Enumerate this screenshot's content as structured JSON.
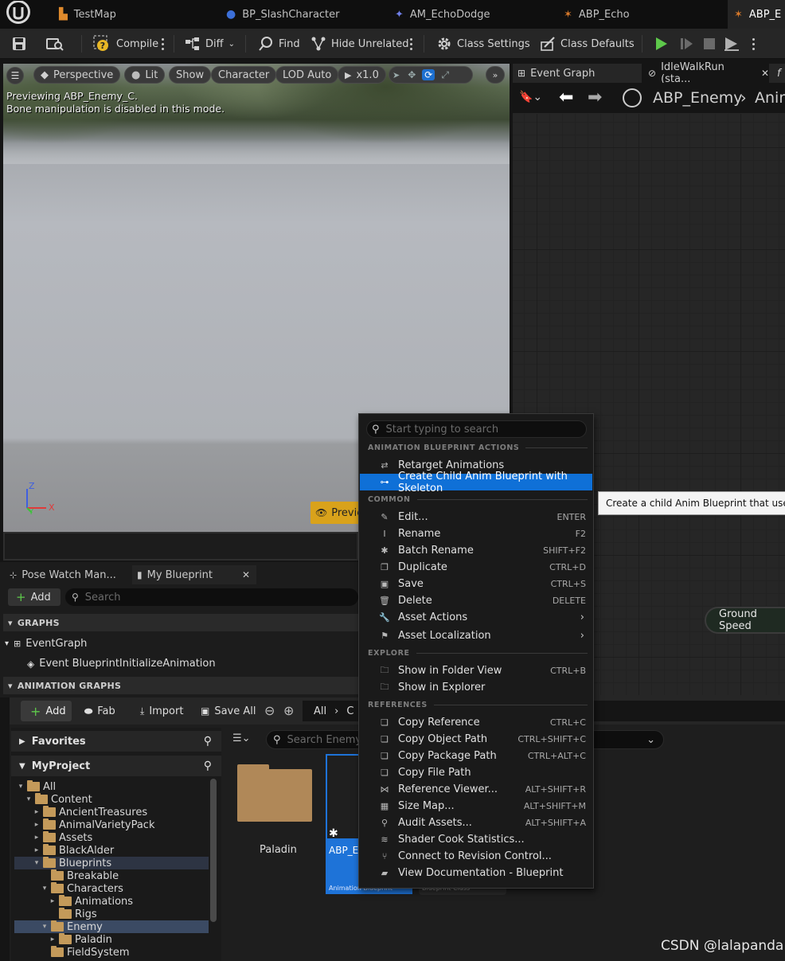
{
  "tabs": [
    "TestMap",
    "BP_SlashCharacter",
    "AM_EchoDodge",
    "ABP_Echo",
    "ABP_E"
  ],
  "toolbar": {
    "compile": "Compile",
    "diff": "Diff",
    "find": "Find",
    "hide_unrelated": "Hide Unrelated",
    "class_settings": "Class Settings",
    "class_defaults": "Class Defaults"
  },
  "viewport": {
    "perspective": "Perspective",
    "lit": "Lit",
    "show": "Show",
    "character": "Character",
    "lod": "LOD Auto",
    "speed": "x1.0",
    "preview_line1": "Previewing ABP_Enemy_C.",
    "preview_line2": "Bone manipulation is disabled in this mode.",
    "preview_button": "Previe",
    "axis_z": "Z",
    "axis_x": "X",
    "axis_y": "Y"
  },
  "graph": {
    "tab_event": "Event Graph",
    "tab_idle": "IdleWalkRun (sta...",
    "tab_f": "f",
    "breadcrumb_root": "ABP_Enemy",
    "breadcrumb_next": "Anim",
    "node_ground_speed": "Ground Speed"
  },
  "my_blueprint": {
    "tab_pose": "Pose Watch Man...",
    "tab_mybp": "My Blueprint",
    "add": "Add",
    "search_placeholder": "Search",
    "graphs_header": "GRAPHS",
    "event_graph": "EventGraph",
    "event_init": "Event BlueprintInitializeAnimation",
    "anim_graphs_header": "ANIMATION GRAPHS"
  },
  "content_browser": {
    "add": "Add",
    "fab": "Fab",
    "import": "Import",
    "save_all": "Save All",
    "path_all": "All",
    "path_next": "C",
    "favorites": "Favorites",
    "project": "MyProject",
    "search_placeholder": "Search Enemy",
    "tree": [
      {
        "label": "All",
        "depth": 0,
        "arrow": "▾"
      },
      {
        "label": "Content",
        "depth": 1,
        "arrow": "▾"
      },
      {
        "label": "AncientTreasures",
        "depth": 2,
        "arrow": "▸"
      },
      {
        "label": "AnimalVarietyPack",
        "depth": 2,
        "arrow": "▸"
      },
      {
        "label": "Assets",
        "depth": 2,
        "arrow": "▸"
      },
      {
        "label": "BlackAlder",
        "depth": 2,
        "arrow": "▸"
      },
      {
        "label": "Blueprints",
        "depth": 2,
        "arrow": "▾"
      },
      {
        "label": "Breakable",
        "depth": 3,
        "arrow": ""
      },
      {
        "label": "Characters",
        "depth": 3,
        "arrow": "▾"
      },
      {
        "label": "Animations",
        "depth": 4,
        "arrow": "▸"
      },
      {
        "label": "Rigs",
        "depth": 4,
        "arrow": ""
      },
      {
        "label": "Enemy",
        "depth": 3,
        "arrow": "▾"
      },
      {
        "label": "Paladin",
        "depth": 4,
        "arrow": "▸"
      },
      {
        "label": "FieldSystem",
        "depth": 3,
        "arrow": ""
      }
    ],
    "asset_folder": "Paladin",
    "asset_abp": "ABP_E",
    "asset_abp_type": "Animation Blueprint",
    "asset_bp_type": "Blueprint Class"
  },
  "context_menu": {
    "search_placeholder": "Start typing to search",
    "sections": {
      "anim": "ANIMATION BLUEPRINT ACTIONS",
      "common": "COMMON",
      "explore": "EXPLORE",
      "references": "REFERENCES"
    },
    "anim_items": [
      {
        "label": "Retarget Animations",
        "shortcut": ""
      },
      {
        "label": "Create Child Anim Blueprint with Skeleton",
        "shortcut": ""
      }
    ],
    "common_items": [
      {
        "label": "Edit...",
        "shortcut": "ENTER"
      },
      {
        "label": "Rename",
        "shortcut": "F2"
      },
      {
        "label": "Batch Rename",
        "shortcut": "SHIFT+F2"
      },
      {
        "label": "Duplicate",
        "shortcut": "CTRL+D"
      },
      {
        "label": "Save",
        "shortcut": "CTRL+S"
      },
      {
        "label": "Delete",
        "shortcut": "DELETE"
      },
      {
        "label": "Asset Actions",
        "shortcut": ""
      },
      {
        "label": "Asset Localization",
        "shortcut": ""
      }
    ],
    "explore_items": [
      {
        "label": "Show in Folder View",
        "shortcut": "CTRL+B"
      },
      {
        "label": "Show in Explorer",
        "shortcut": ""
      }
    ],
    "reference_items": [
      {
        "label": "Copy Reference",
        "shortcut": "CTRL+C"
      },
      {
        "label": "Copy Object Path",
        "shortcut": "CTRL+SHIFT+C"
      },
      {
        "label": "Copy Package Path",
        "shortcut": "CTRL+ALT+C"
      },
      {
        "label": "Copy File Path",
        "shortcut": ""
      },
      {
        "label": "Reference Viewer...",
        "shortcut": "ALT+SHIFT+R"
      },
      {
        "label": "Size Map...",
        "shortcut": "ALT+SHIFT+M"
      },
      {
        "label": "Audit Assets...",
        "shortcut": "ALT+SHIFT+A"
      },
      {
        "label": "Shader Cook Statistics...",
        "shortcut": ""
      },
      {
        "label": "Connect to Revision Control...",
        "shortcut": ""
      },
      {
        "label": "View Documentation - Blueprint",
        "shortcut": ""
      }
    ]
  },
  "tooltip": "Create a child Anim Blueprint that uses a d",
  "watermark": "CSDN @lalapanda",
  "colors": {
    "accent": "#0f70d7",
    "play": "#5ec94b",
    "preview": "#d9a21b"
  }
}
